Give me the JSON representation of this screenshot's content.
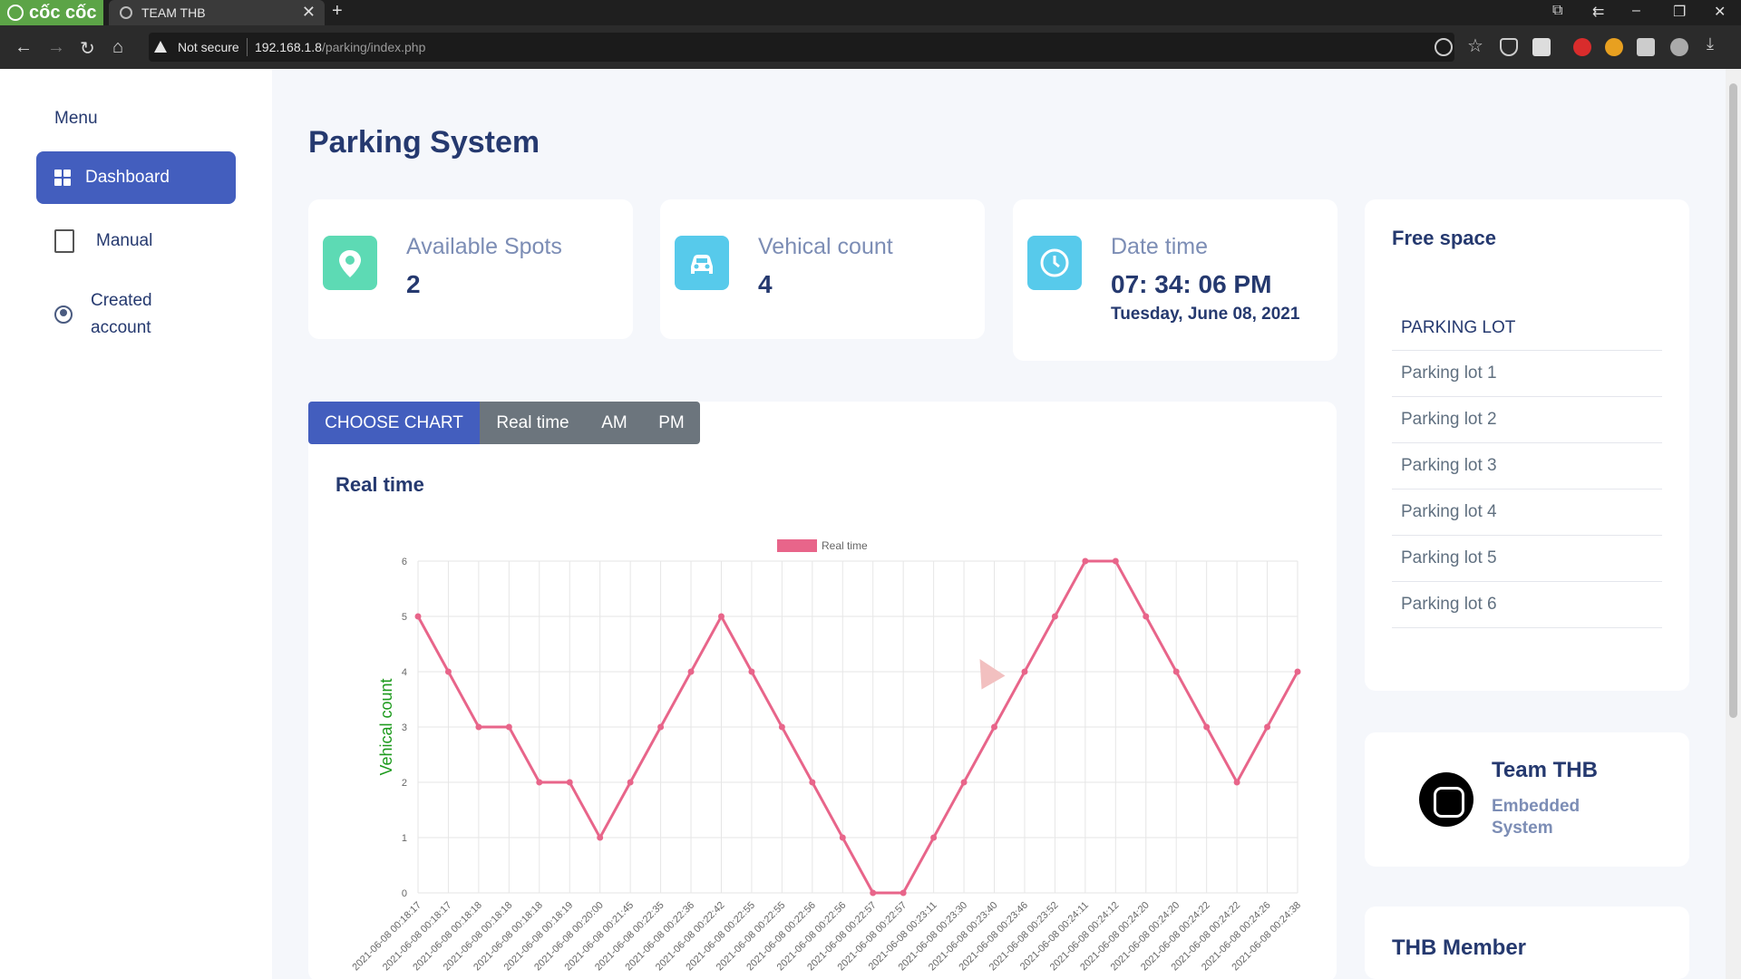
{
  "browser": {
    "brand": "cốc cốc",
    "tab_title": "TEAM THB",
    "tab_close": "✕",
    "new_tab": "+",
    "security": "Not secure",
    "url_host": "192.168.1.8",
    "url_path": "/parking/index.php"
  },
  "sidebar": {
    "menu_title": "Menu",
    "items": [
      {
        "label": "Dashboard"
      },
      {
        "label": "Manual"
      },
      {
        "label_line1": "Created",
        "label_line2": "account"
      }
    ]
  },
  "page": {
    "title": "Parking System"
  },
  "stats": [
    {
      "label": "Available Spots",
      "value": "2",
      "icon": "location-pin-icon",
      "color": "#57caeb"
    },
    {
      "label": "Vehical count",
      "value": "4",
      "icon": "car-icon",
      "color": "#5ddab4"
    },
    {
      "label": "Date time",
      "value": "07: 34: 06 PM",
      "sub": "Tuesday, June 08, 2021",
      "icon": "clock-icon",
      "color": "#57caeb"
    }
  ],
  "chart_buttons": {
    "choose": "CHOOSE CHART",
    "realtime": "Real time",
    "am": "AM",
    "pm": "PM"
  },
  "chart_title": "Real time",
  "chart_data": {
    "type": "line",
    "series": [
      {
        "name": "Real time",
        "color": "#e8658a",
        "values": [
          5,
          4,
          3,
          3,
          2,
          2,
          1,
          2,
          3,
          4,
          5,
          4,
          3,
          2,
          1,
          0,
          0,
          1,
          2,
          3,
          4,
          5,
          6,
          6,
          5,
          4,
          3,
          2,
          3,
          4
        ]
      }
    ],
    "x": [
      "2021-06-08 00:18:17",
      "2021-06-08 00:18:17",
      "2021-06-08 00:18:18",
      "2021-06-08 00:18:18",
      "2021-06-08 00:18:18",
      "2021-06-08 00:18:19",
      "2021-06-08 00:20:00",
      "2021-06-08 00:21:45",
      "2021-06-08 00:22:35",
      "2021-06-08 00:22:36",
      "2021-06-08 00:22:42",
      "2021-06-08 00:22:55",
      "2021-06-08 00:22:55",
      "2021-06-08 00:22:56",
      "2021-06-08 00:22:56",
      "2021-06-08 00:22:57",
      "2021-06-08 00:22:57",
      "2021-06-08 00:23:11",
      "2021-06-08 00:23:30",
      "2021-06-08 00:23:40",
      "2021-06-08 00:23:46",
      "2021-06-08 00:23:52",
      "2021-06-08 00:24:11",
      "2021-06-08 00:24:12",
      "2021-06-08 00:24:20",
      "2021-06-08 00:24:20",
      "2021-06-08 00:24:22",
      "2021-06-08 00:24:22",
      "2021-06-08 00:24:26",
      "2021-06-08 00:24:38"
    ],
    "ylabel": "Vehical count",
    "ylim": [
      0,
      6
    ],
    "yticks": [
      "0",
      "1",
      "2",
      "3",
      "4",
      "5",
      "6"
    ],
    "grid": true,
    "legend": "top"
  },
  "free_space": {
    "title": "Free space",
    "header": "PARKING LOT",
    "lots": [
      "Parking lot 1",
      "Parking lot 2",
      "Parking lot 3",
      "Parking lot 4",
      "Parking lot 5",
      "Parking lot 6"
    ]
  },
  "team": {
    "name": "Team THB",
    "sub": "Embedded System",
    "members_title": "THB Member"
  }
}
